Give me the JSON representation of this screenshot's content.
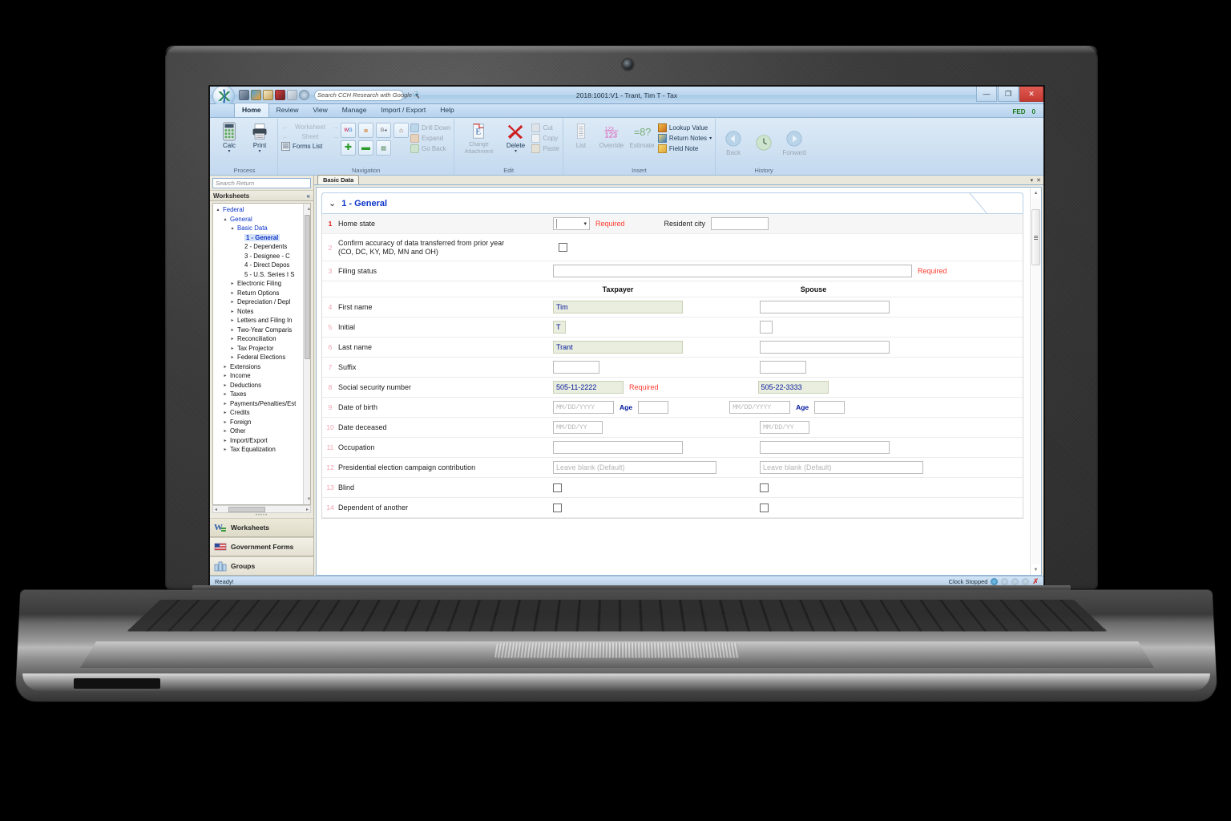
{
  "window": {
    "title": "2018:1001:V1 - Trant, Tim T - Tax",
    "minimize": "—",
    "restore": "❐",
    "close": "✕",
    "fed_label": "FED",
    "fed_value": "0"
  },
  "quick_access": {
    "search_placeholder": "Search CCH Research with Google",
    "search_icon": "search-icon",
    "dropdown_icon": "chevron-down-icon",
    "icons": [
      "globe-icon",
      "umbrella-icon",
      "clipboard-icon",
      "book-icon",
      "list-icon",
      "info-icon"
    ]
  },
  "ribbon": {
    "tabs": [
      {
        "label": "Home",
        "active": true
      },
      {
        "label": "Review",
        "active": false
      },
      {
        "label": "View",
        "active": false
      },
      {
        "label": "Manage",
        "active": false
      },
      {
        "label": "Import / Export",
        "active": false
      },
      {
        "label": "Help",
        "active": false
      }
    ],
    "groups": [
      {
        "name": "Process",
        "label": "Process",
        "buttons": [
          {
            "label": "Calc",
            "icon": "calculator-icon",
            "arrow": "▾"
          },
          {
            "label": "Print",
            "icon": "printer-icon",
            "arrow": "▾"
          }
        ]
      },
      {
        "name": "Navigation",
        "label": "Navigation",
        "nav_rows": [
          {
            "label": "Worksheet",
            "left": "←",
            "right": "→"
          },
          {
            "label": "Sheet",
            "left": "←",
            "right": "→"
          }
        ],
        "forms_list": "Forms List",
        "forms_list_icon": "forms-list-icon",
        "square_icons": [
          "wg-icon",
          "outline-icon",
          "g-back-icon",
          "home-icon",
          "plus-icon",
          "minus-icon",
          "sheet-icon"
        ],
        "side_items": [
          {
            "label": "Drill Down",
            "icon": "drill-down-icon"
          },
          {
            "label": "Expand",
            "icon": "expand-icon"
          },
          {
            "label": "Go Back",
            "icon": "go-back-icon"
          }
        ]
      },
      {
        "name": "Edit",
        "label": "Edit",
        "buttons": [
          {
            "label": "Change",
            "label2": "Attachment",
            "icon": "change-attachment-icon",
            "arrow": "▾"
          },
          {
            "label": "Delete",
            "icon": "delete-x-icon",
            "arrow": "▾"
          }
        ],
        "side_items": [
          {
            "label": "Cut",
            "icon": "cut-icon"
          },
          {
            "label": "Copy",
            "icon": "copy-icon"
          },
          {
            "label": "Paste",
            "icon": "paste-icon"
          }
        ]
      },
      {
        "name": "Insert",
        "label": "Insert",
        "buttons": [
          {
            "label": "List",
            "icon": "list-icon"
          },
          {
            "label": "Override",
            "icon": "override-123-icon"
          },
          {
            "label": "Estimate",
            "icon": "estimate-icon"
          }
        ],
        "side_items": [
          {
            "label": "Lookup Value",
            "icon": "lookup-value-icon"
          },
          {
            "label": "Return Notes",
            "icon": "return-notes-icon",
            "arrow": "▾"
          },
          {
            "label": "Field Note",
            "icon": "field-note-icon"
          }
        ]
      },
      {
        "name": "History",
        "label": "History",
        "buttons": [
          {
            "label": "Back",
            "icon": "back-arrow-icon"
          },
          {
            "label": "",
            "icon": "clock-icon"
          },
          {
            "label": "Forward",
            "icon": "forward-arrow-icon"
          }
        ]
      }
    ]
  },
  "worksheet_tab": {
    "label": "Basic Data"
  },
  "sidebar": {
    "search_placeholder": "Search Return",
    "header": "Worksheets",
    "collapse_icon": "collapse-left-icon",
    "tree": [
      {
        "label": "Federal",
        "depth": 0,
        "twisty": "▴",
        "style": "blue"
      },
      {
        "label": "General",
        "depth": 1,
        "twisty": "▴",
        "style": "blue"
      },
      {
        "label": "Basic Data",
        "depth": 2,
        "twisty": "▴",
        "style": "blue"
      },
      {
        "label": "1 - General",
        "depth": 3,
        "twisty": "",
        "style": "sel"
      },
      {
        "label": "2 - Dependents",
        "depth": 3,
        "twisty": "",
        "style": ""
      },
      {
        "label": "3 - Designee - C",
        "depth": 3,
        "twisty": "",
        "style": ""
      },
      {
        "label": "4 - Direct Depos",
        "depth": 3,
        "twisty": "",
        "style": ""
      },
      {
        "label": "5 - U.S. Series I S",
        "depth": 3,
        "twisty": "",
        "style": ""
      },
      {
        "label": "Electronic Filing",
        "depth": 2,
        "twisty": "▸",
        "style": ""
      },
      {
        "label": "Return Options",
        "depth": 2,
        "twisty": "▸",
        "style": ""
      },
      {
        "label": "Depreciation / Depl",
        "depth": 2,
        "twisty": "▸",
        "style": ""
      },
      {
        "label": "Notes",
        "depth": 2,
        "twisty": "▸",
        "style": ""
      },
      {
        "label": "Letters and Filing In",
        "depth": 2,
        "twisty": "▸",
        "style": ""
      },
      {
        "label": "Two-Year Comparis",
        "depth": 2,
        "twisty": "▸",
        "style": ""
      },
      {
        "label": "Reconciliation",
        "depth": 2,
        "twisty": "▸",
        "style": ""
      },
      {
        "label": "Tax Projector",
        "depth": 2,
        "twisty": "▸",
        "style": ""
      },
      {
        "label": "Federal Elections",
        "depth": 2,
        "twisty": "▸",
        "style": ""
      },
      {
        "label": "Extensions",
        "depth": 1,
        "twisty": "▸",
        "style": ""
      },
      {
        "label": "Income",
        "depth": 1,
        "twisty": "▸",
        "style": ""
      },
      {
        "label": "Deductions",
        "depth": 1,
        "twisty": "▸",
        "style": ""
      },
      {
        "label": "Taxes",
        "depth": 1,
        "twisty": "▸",
        "style": ""
      },
      {
        "label": "Payments/Penalties/Est",
        "depth": 1,
        "twisty": "▸",
        "style": ""
      },
      {
        "label": "Credits",
        "depth": 1,
        "twisty": "▸",
        "style": ""
      },
      {
        "label": "Foreign",
        "depth": 1,
        "twisty": "▸",
        "style": ""
      },
      {
        "label": "Other",
        "depth": 1,
        "twisty": "▸",
        "style": ""
      },
      {
        "label": "Import/Export",
        "depth": 1,
        "twisty": "▸",
        "style": ""
      },
      {
        "label": "Tax Equalization",
        "depth": 1,
        "twisty": "▸",
        "style": ""
      }
    ],
    "nav_buttons": [
      {
        "label": "Worksheets",
        "icon": "worksheets-icon",
        "selected": true
      },
      {
        "label": "Government Forms",
        "icon": "government-forms-icon",
        "selected": false
      },
      {
        "label": "Groups",
        "icon": "groups-icon",
        "selected": false
      }
    ]
  },
  "document": {
    "tab": "Basic Data",
    "section_title": "1 - General",
    "section_chevron": "⌄⌄",
    "column_headers": {
      "taxpayer": "Taxpayer",
      "spouse": "Spouse"
    },
    "rows": [
      {
        "num": "1",
        "label": "Home state",
        "kind": "home-state",
        "dropdown_value": "",
        "required": "Required",
        "second_label": "Resident city",
        "resident_city": ""
      },
      {
        "num": "2",
        "kind": "checkbox-single",
        "label": "Confirm accuracy of data transferred from prior year (CO, DC, KY, MD, MN and OH)",
        "label_line1": "Confirm accuracy of data transferred from prior year",
        "label_line2": "(CO, DC, KY, MD, MN and OH)",
        "checked": false
      },
      {
        "num": "3",
        "label": "Filing status",
        "kind": "wide-input",
        "value": "",
        "required": "Required"
      },
      {
        "num": "4",
        "label": "First name",
        "kind": "pair",
        "taxpayer": "Tim",
        "spouse": "",
        "taxpayer_filled": true,
        "width": "wide"
      },
      {
        "num": "5",
        "label": "Initial",
        "kind": "pair",
        "taxpayer": "T",
        "spouse": "",
        "taxpayer_filled": true,
        "width": "tiny"
      },
      {
        "num": "6",
        "label": "Last name",
        "kind": "pair",
        "taxpayer": "Trant",
        "spouse": "",
        "taxpayer_filled": true,
        "width": "wide"
      },
      {
        "num": "7",
        "label": "Suffix",
        "kind": "pair",
        "taxpayer": "",
        "spouse": "",
        "taxpayer_filled": false,
        "width": "small"
      },
      {
        "num": "8",
        "label": "Social security number",
        "kind": "pair-required",
        "taxpayer": "505-11-2222",
        "spouse": "505-22-3333",
        "taxpayer_filled": true,
        "spouse_filled": true,
        "required": "Required",
        "width": "ssn"
      },
      {
        "num": "9",
        "label": "Date of birth",
        "kind": "date-age",
        "taxpayer_placeholder": "MM/DD/YYYY",
        "spouse_placeholder": "MM/DD/YYYY",
        "age_label": "Age",
        "taxpayer_age": "",
        "spouse_age": ""
      },
      {
        "num": "10",
        "label": "Date deceased",
        "kind": "date",
        "taxpayer_placeholder": "MM/DD/YY",
        "spouse_placeholder": "MM/DD/YY"
      },
      {
        "num": "11",
        "label": "Occupation",
        "kind": "pair",
        "taxpayer": "",
        "spouse": "",
        "taxpayer_filled": false,
        "width": "wide"
      },
      {
        "num": "12",
        "label": "Presidential election campaign contribution",
        "kind": "pair-placeholder",
        "taxpayer_placeholder": "Leave blank (Default)",
        "spouse_placeholder": "Leave blank (Default)"
      },
      {
        "num": "13",
        "label": "Blind",
        "kind": "checkbox-pair",
        "taxpayer_checked": false,
        "spouse_checked": false
      },
      {
        "num": "14",
        "label": "Dependent of another",
        "kind": "checkbox-pair",
        "taxpayer_checked": false,
        "spouse_checked": false
      }
    ]
  },
  "status_bar": {
    "message": "Ready!",
    "clock_label": "Clock Stopped",
    "icons": [
      "play-icon",
      "pause-icon",
      "next-icon",
      "info-icon",
      "close-red-icon"
    ]
  },
  "colors": {
    "accent_blue": "#0b33c9",
    "required_red": "#ff3b30",
    "filled_field_bg": "#e9eede",
    "fed_green": "#1a7a1a",
    "close_red": "#c43a32"
  }
}
